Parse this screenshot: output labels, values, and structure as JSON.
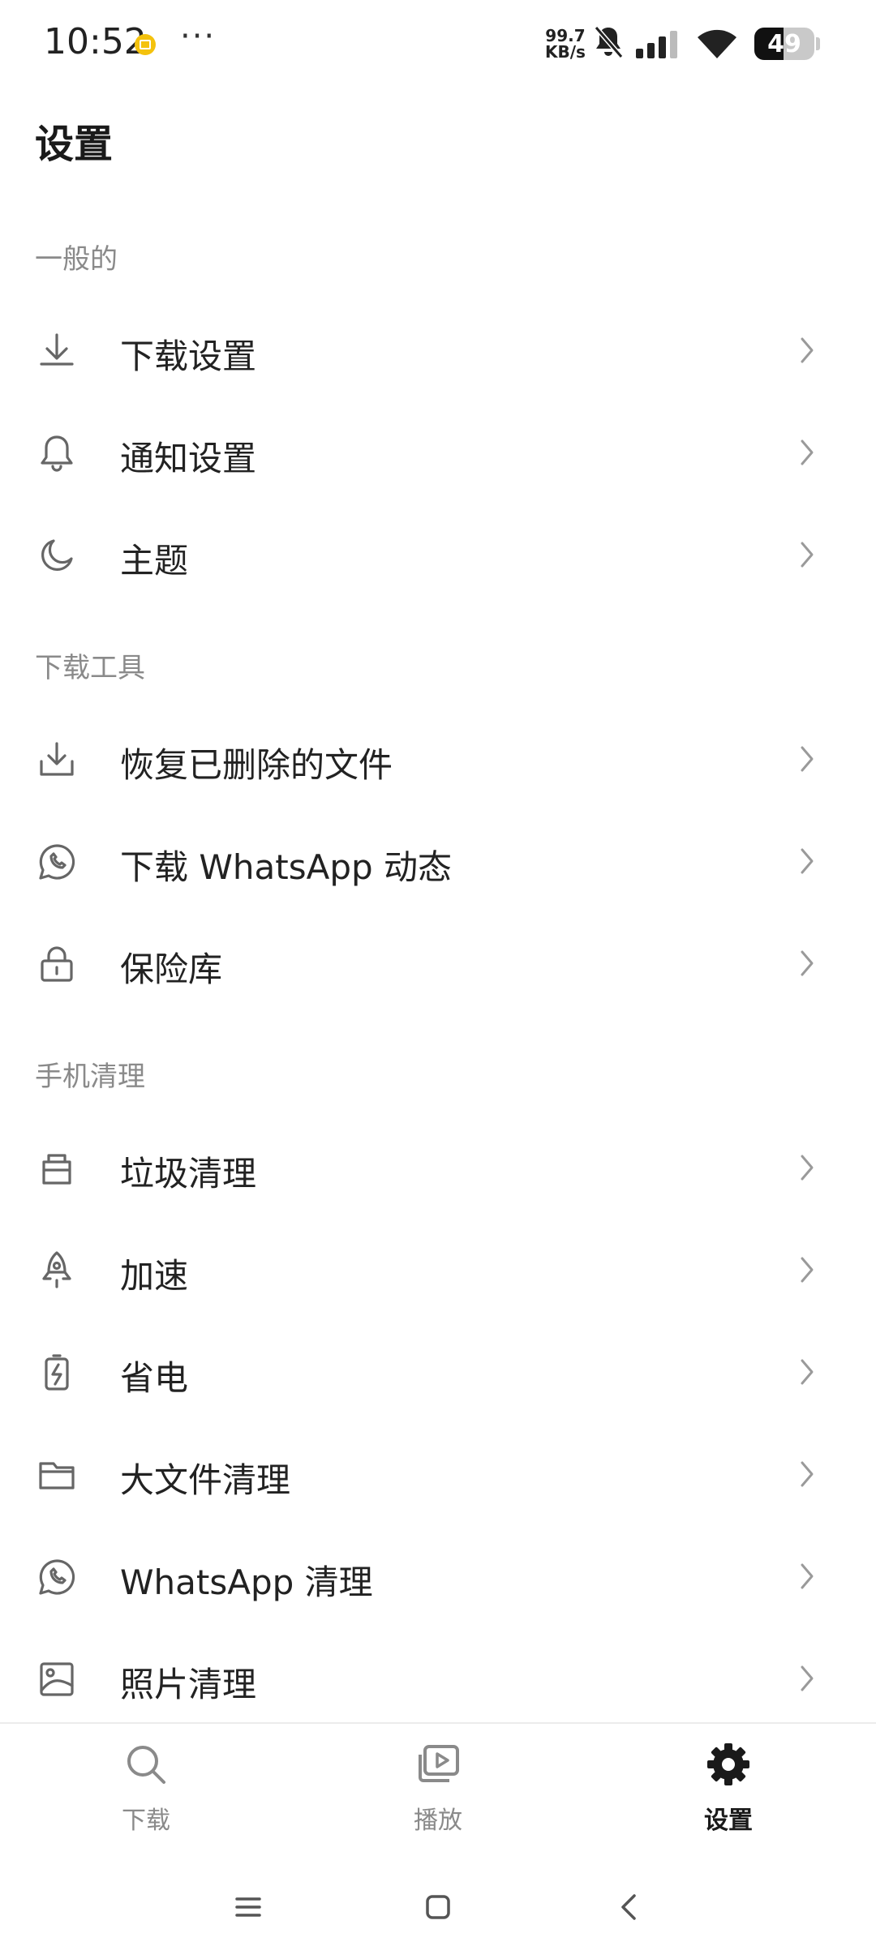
{
  "status_bar": {
    "time": "10:52",
    "more": "···",
    "speed_value": "99.7",
    "speed_unit": "KB/s",
    "battery_level": "49",
    "battery_fraction": 0.49,
    "icons": [
      "app-notification-icon",
      "mute-bell-icon",
      "signal-icon",
      "wifi-icon",
      "battery-icon"
    ]
  },
  "page": {
    "title": "设置"
  },
  "sections": [
    {
      "header": "一般的",
      "items": [
        {
          "label": "下载设置",
          "icon": "download-icon"
        },
        {
          "label": "通知设置",
          "icon": "bell-icon"
        },
        {
          "label": "主题",
          "icon": "moon-icon"
        }
      ]
    },
    {
      "header": "下载工具",
      "items": [
        {
          "label": "恢复已删除的文件",
          "icon": "tray-download-icon"
        },
        {
          "label": "下载 WhatsApp 动态",
          "icon": "whatsapp-icon"
        },
        {
          "label": "保险库",
          "icon": "lock-icon"
        }
      ]
    },
    {
      "header": "手机清理",
      "items": [
        {
          "label": "垃圾清理",
          "icon": "junk-bin-icon"
        },
        {
          "label": "加速",
          "icon": "rocket-icon"
        },
        {
          "label": "省电",
          "icon": "battery-bolt-icon"
        },
        {
          "label": "大文件清理",
          "icon": "folder-icon"
        },
        {
          "label": "WhatsApp 清理",
          "icon": "whatsapp-icon"
        },
        {
          "label": "照片清理",
          "icon": "image-icon"
        }
      ]
    }
  ],
  "bottom_nav": [
    {
      "label": "下载",
      "icon": "search-icon",
      "active": false
    },
    {
      "label": "播放",
      "icon": "play-stack-icon",
      "active": false
    },
    {
      "label": "设置",
      "icon": "gear-icon",
      "active": true
    }
  ],
  "colors": {
    "text_primary": "#222222",
    "text_secondary": "#8a8a8a",
    "icon": "#666666",
    "chevron": "#9a9a9a",
    "accent_coin": "#f4c20d"
  }
}
